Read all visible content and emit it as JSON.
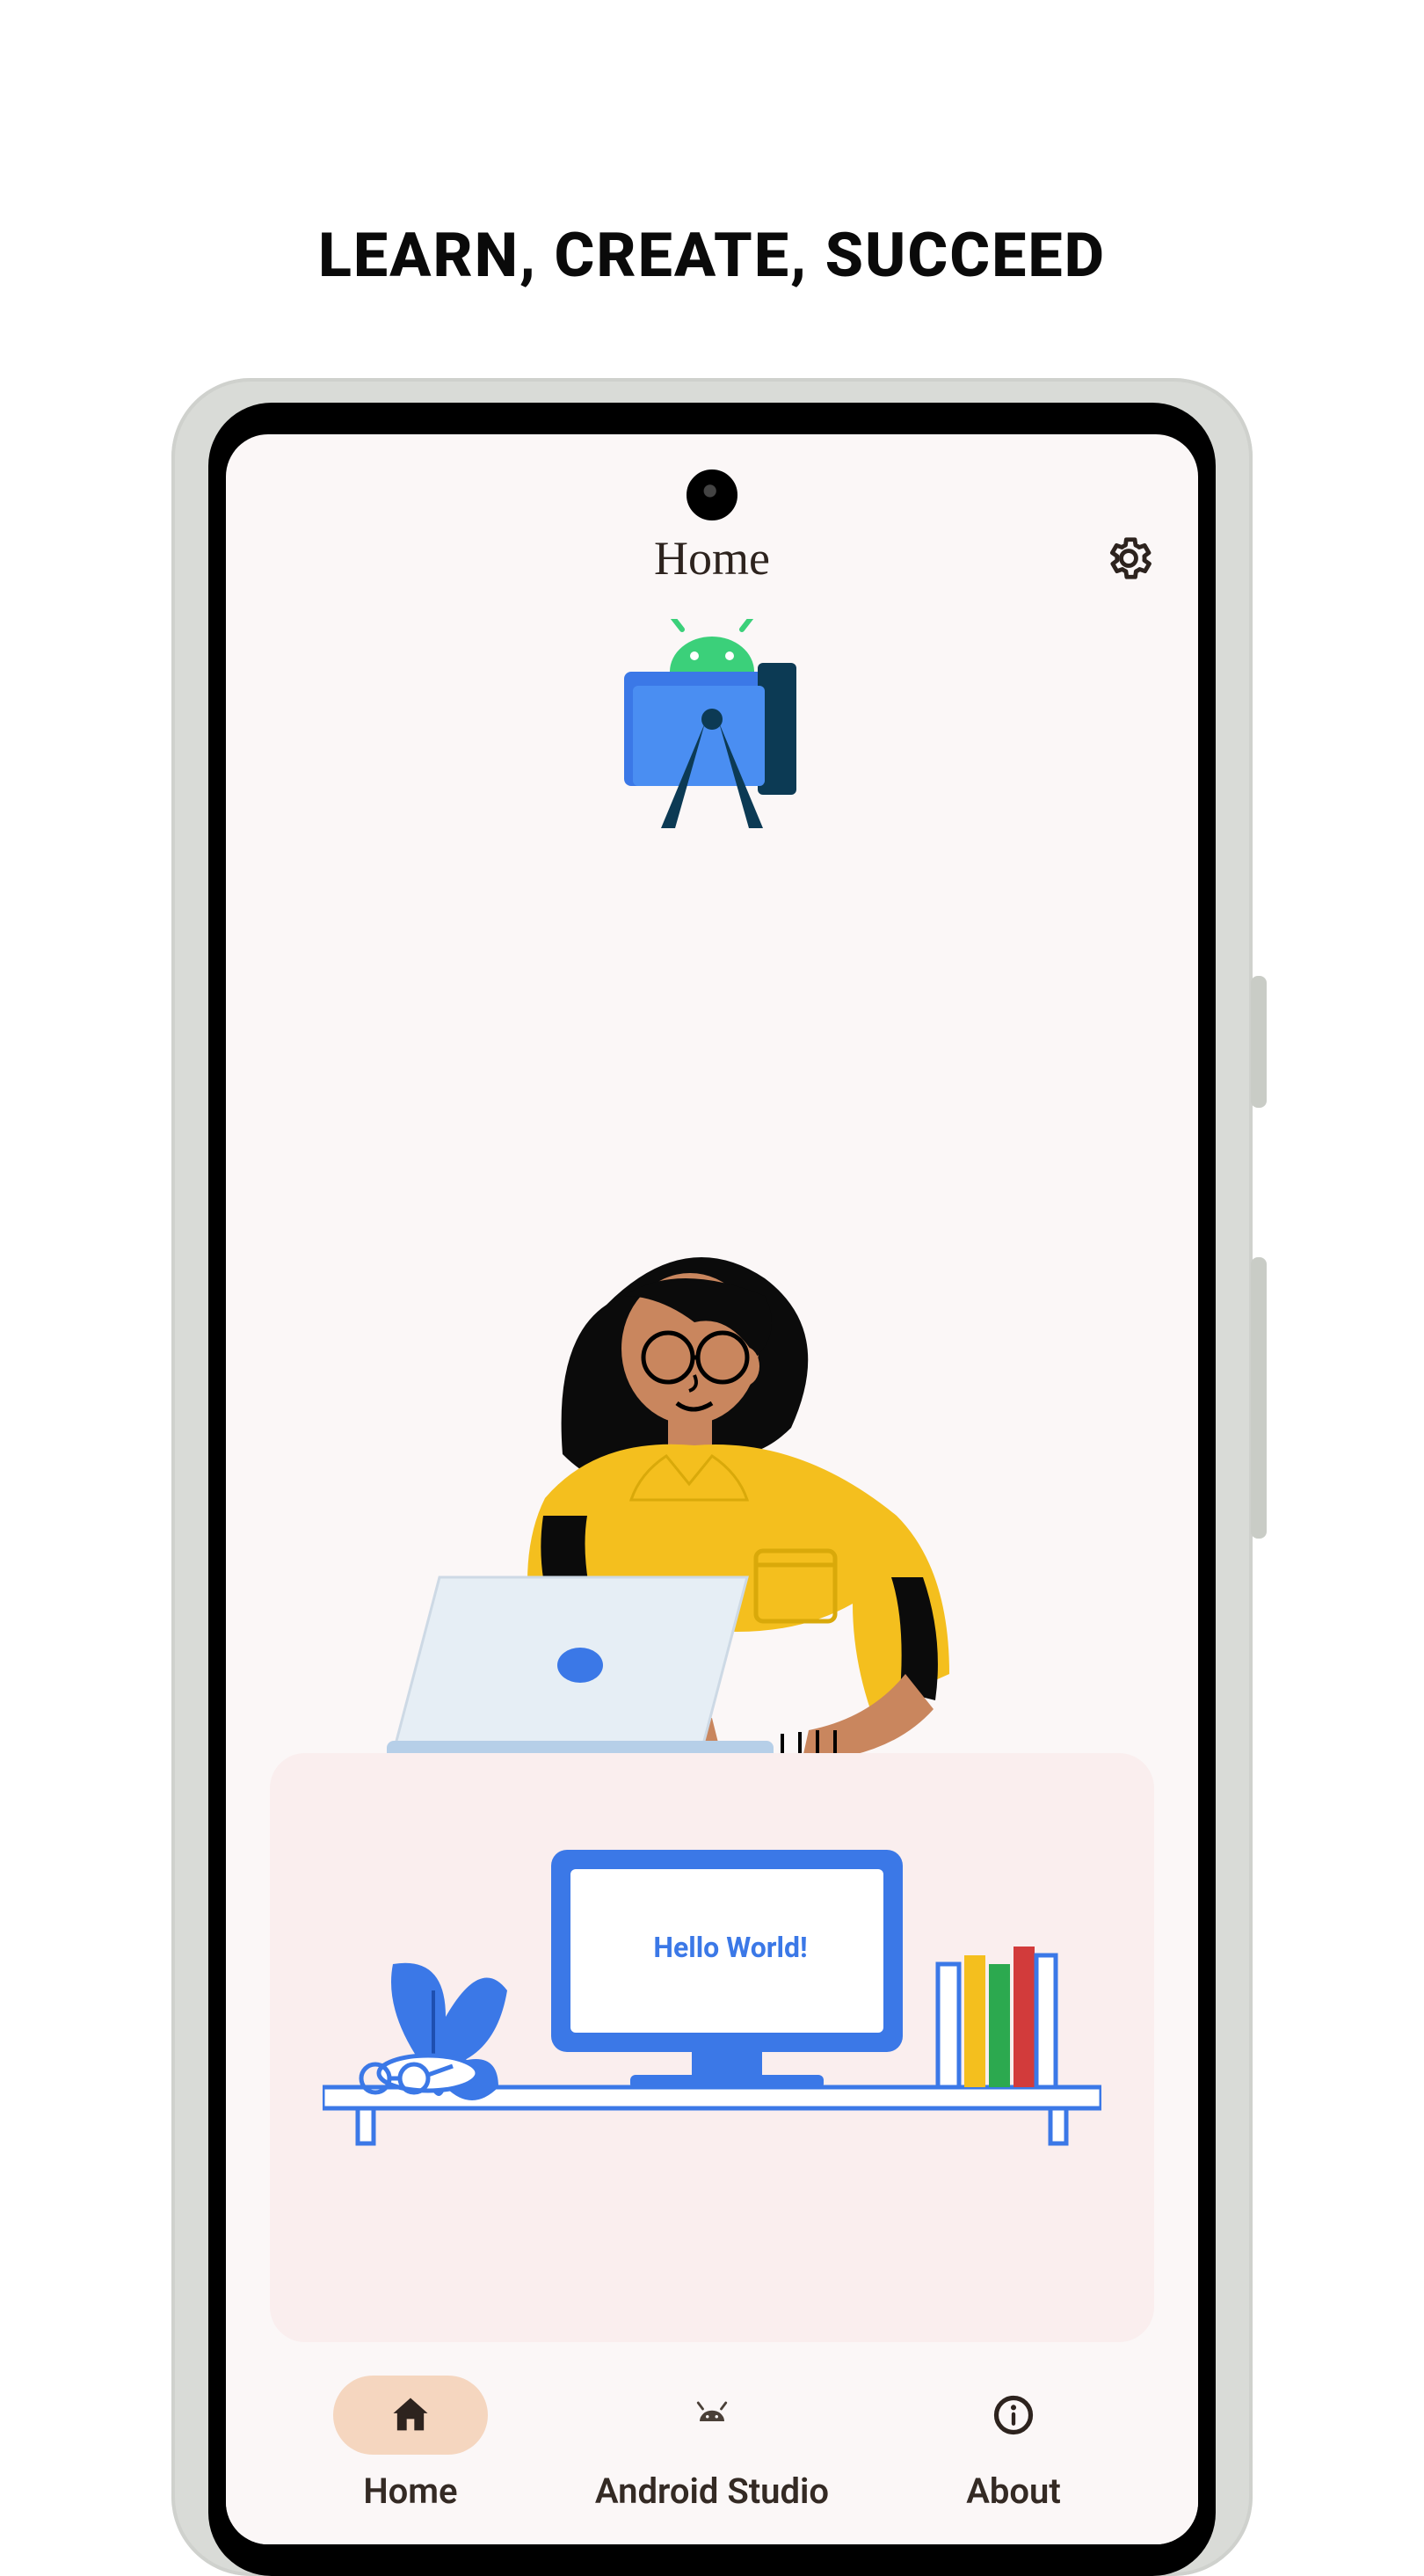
{
  "headline": "LEARN, CREATE, SUCCEED",
  "header": {
    "title": "Home"
  },
  "illustration": {
    "monitor_text": "Hello World!"
  },
  "nav": {
    "items": [
      {
        "label": "Home",
        "active": true
      },
      {
        "label": "Android Studio",
        "active": false
      },
      {
        "label": "About",
        "active": false
      }
    ]
  }
}
